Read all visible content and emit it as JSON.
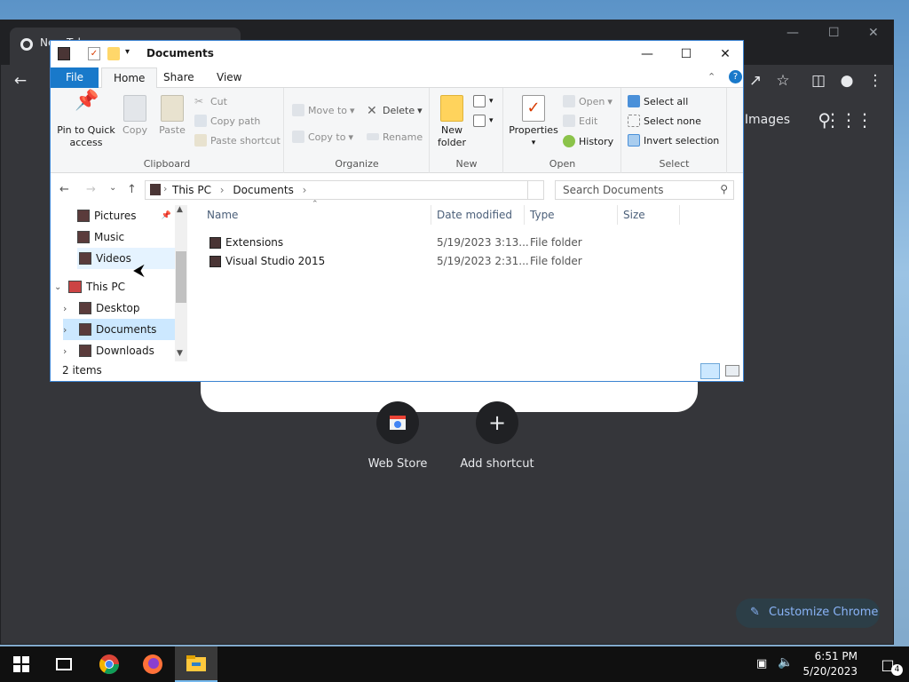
{
  "chrome": {
    "tab_title": "New Tab",
    "images_label": "Images",
    "shortcuts": [
      {
        "label": "Web Store",
        "icon": "web-store-icon"
      },
      {
        "label": "Add shortcut",
        "icon": "plus-icon",
        "glyph": "+"
      }
    ],
    "customize_label": "Customize Chrome"
  },
  "explorer": {
    "title": "Documents",
    "ribbon_tabs": [
      "File",
      "Home",
      "Share",
      "View"
    ],
    "clipboard": {
      "group_label": "Clipboard",
      "pin_label_1": "Pin to Quick",
      "pin_label_2": "access",
      "copy_label": "Copy",
      "paste_label": "Paste",
      "cut_label": "Cut",
      "copy_path_label": "Copy path",
      "paste_shortcut_label": "Paste shortcut"
    },
    "organize": {
      "group_label": "Organize",
      "move_to_label": "Move to",
      "copy_to_label": "Copy to",
      "delete_label": "Delete",
      "rename_label": "Rename"
    },
    "new": {
      "group_label": "New",
      "new_folder_label_1": "New",
      "new_folder_label_2": "folder"
    },
    "open": {
      "group_label": "Open",
      "properties_label": "Properties",
      "open_label": "Open",
      "edit_label": "Edit",
      "history_label": "History"
    },
    "select": {
      "group_label": "Select",
      "select_all_label": "Select all",
      "select_none_label": "Select none",
      "invert_label": "Invert selection"
    },
    "address": {
      "crumb_1": "This PC",
      "crumb_2": "Documents",
      "search_placeholder": "Search Documents"
    },
    "nav_pane": [
      {
        "label": "Pictures"
      },
      {
        "label": "Music"
      },
      {
        "label": "Videos"
      },
      {
        "label": "This PC"
      },
      {
        "label": "Desktop"
      },
      {
        "label": "Documents"
      },
      {
        "label": "Downloads"
      }
    ],
    "columns": [
      "Name",
      "Date modified",
      "Type",
      "Size"
    ],
    "files": [
      {
        "name": "Extensions",
        "date": "5/19/2023 3:13...",
        "type": "File folder",
        "size": ""
      },
      {
        "name": "Visual Studio 2015",
        "date": "5/19/2023 2:31...",
        "type": "File folder",
        "size": ""
      }
    ],
    "status": "2 items"
  },
  "taskbar": {
    "time": "6:51 PM",
    "date": "5/20/2023",
    "notification_count": "4"
  }
}
